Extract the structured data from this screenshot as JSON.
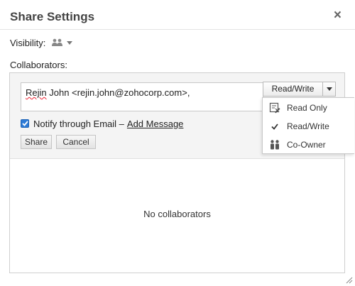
{
  "dialog": {
    "title": "Share Settings",
    "close_glyph": "×"
  },
  "visibility": {
    "label": "Visibility:",
    "icon": "group-people-icon"
  },
  "collaborators": {
    "label": "Collaborators:",
    "input_misspelled": "Rejin",
    "input_rest": " John <rejin.john@zohocorp.com>,",
    "permission_selected": "Read/Write",
    "notify_label": "Notify through Email –",
    "notify_checked": true,
    "add_message": "Add Message",
    "share_button": "Share",
    "cancel_button": "Cancel",
    "empty_message": "No collaborators"
  },
  "permission_menu": {
    "items": [
      {
        "label": "Read Only",
        "icon": "read-only-icon"
      },
      {
        "label": "Read/Write",
        "icon": "checkmark-icon",
        "selected": true
      },
      {
        "label": "Co-Owner",
        "icon": "co-owner-icon"
      }
    ]
  },
  "colors": {
    "checkbox": "#2e7bd6",
    "panel_bg": "#f4f4f4",
    "border": "#cfcfcf"
  }
}
